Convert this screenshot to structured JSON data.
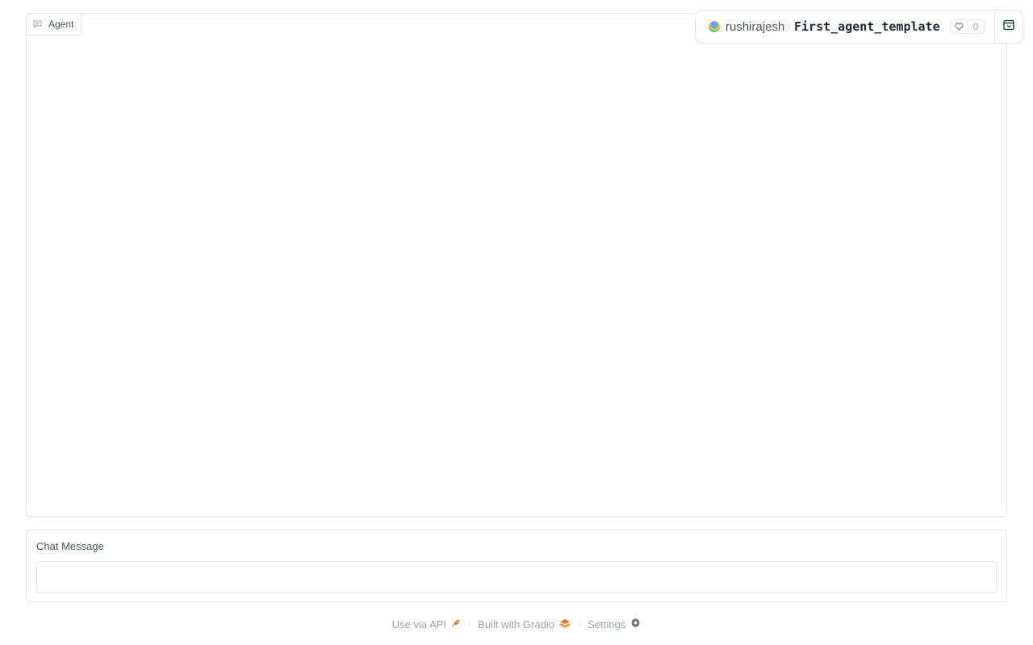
{
  "chatbot": {
    "label": "Agent",
    "label_icon": "chat-icon"
  },
  "space": {
    "owner": "rushirajesh",
    "separator": "/",
    "name": "First_agent_template",
    "likes": "0",
    "like_icon": "heart-icon",
    "collapse_icon": "collapse-icon"
  },
  "chat_input": {
    "label": "Chat Message",
    "value": "",
    "placeholder": ""
  },
  "footer": {
    "api_label": "Use via API",
    "api_icon": "rocket-icon",
    "separator": "·",
    "built_label": "Built with Gradio",
    "gradio_icon": "gradio-logo-icon",
    "settings_label": "Settings",
    "settings_icon": "gear-icon"
  },
  "colors": {
    "border": "#e5e7eb",
    "text_muted": "#9ca3af",
    "accent_orange": "#f97316"
  }
}
